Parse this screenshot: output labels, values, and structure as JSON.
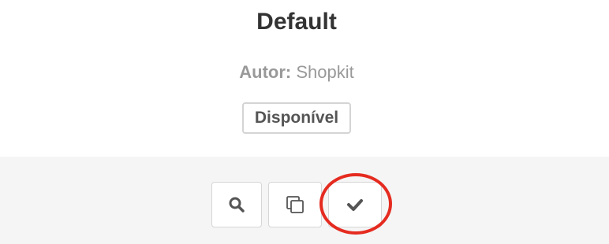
{
  "theme": {
    "name": "Default",
    "author_label": "Autor:",
    "author_name": "Shopkit",
    "status": "Disponível"
  },
  "actions": [
    {
      "icon": "search-icon",
      "name": "preview"
    },
    {
      "icon": "copy-icon",
      "name": "duplicate"
    },
    {
      "icon": "check-icon",
      "name": "activate"
    }
  ],
  "colors": {
    "highlight": "#e52b20",
    "footer_bg": "#f5f5f5",
    "text": "#333333",
    "muted": "#999999"
  }
}
